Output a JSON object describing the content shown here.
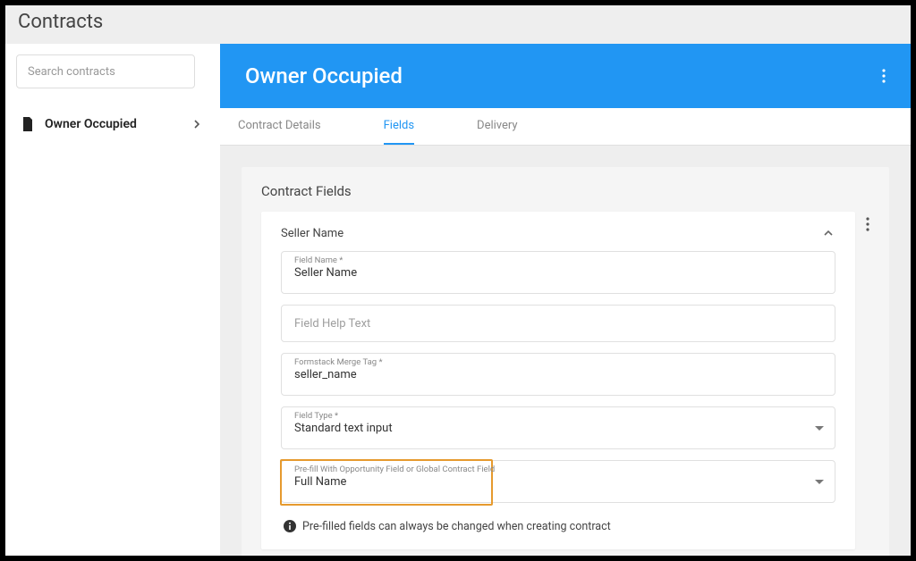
{
  "page_title": "Contracts",
  "sidebar": {
    "search_placeholder": "Search contracts",
    "items": [
      {
        "label": "Owner Occupied"
      }
    ]
  },
  "hero": {
    "title": "Owner Occupied"
  },
  "tabs": [
    {
      "label": "Contract Details",
      "active": false
    },
    {
      "label": "Fields",
      "active": true
    },
    {
      "label": "Delivery",
      "active": false
    }
  ],
  "panel": {
    "title": "Contract Fields",
    "card": {
      "title": "Seller Name",
      "fields": {
        "field_name": {
          "label": "Field Name *",
          "value": "Seller Name"
        },
        "help_text": {
          "placeholder": "Field Help Text"
        },
        "merge_tag": {
          "label": "Formstack Merge Tag *",
          "value": "seller_name"
        },
        "field_type": {
          "label": "Field Type *",
          "value": "Standard text input"
        },
        "prefill": {
          "label": "Pre-fill With Opportunity Field or Global Contract Field",
          "value": "Full Name"
        }
      },
      "info": "Pre-filled fields can always be changed when creating contract"
    }
  }
}
